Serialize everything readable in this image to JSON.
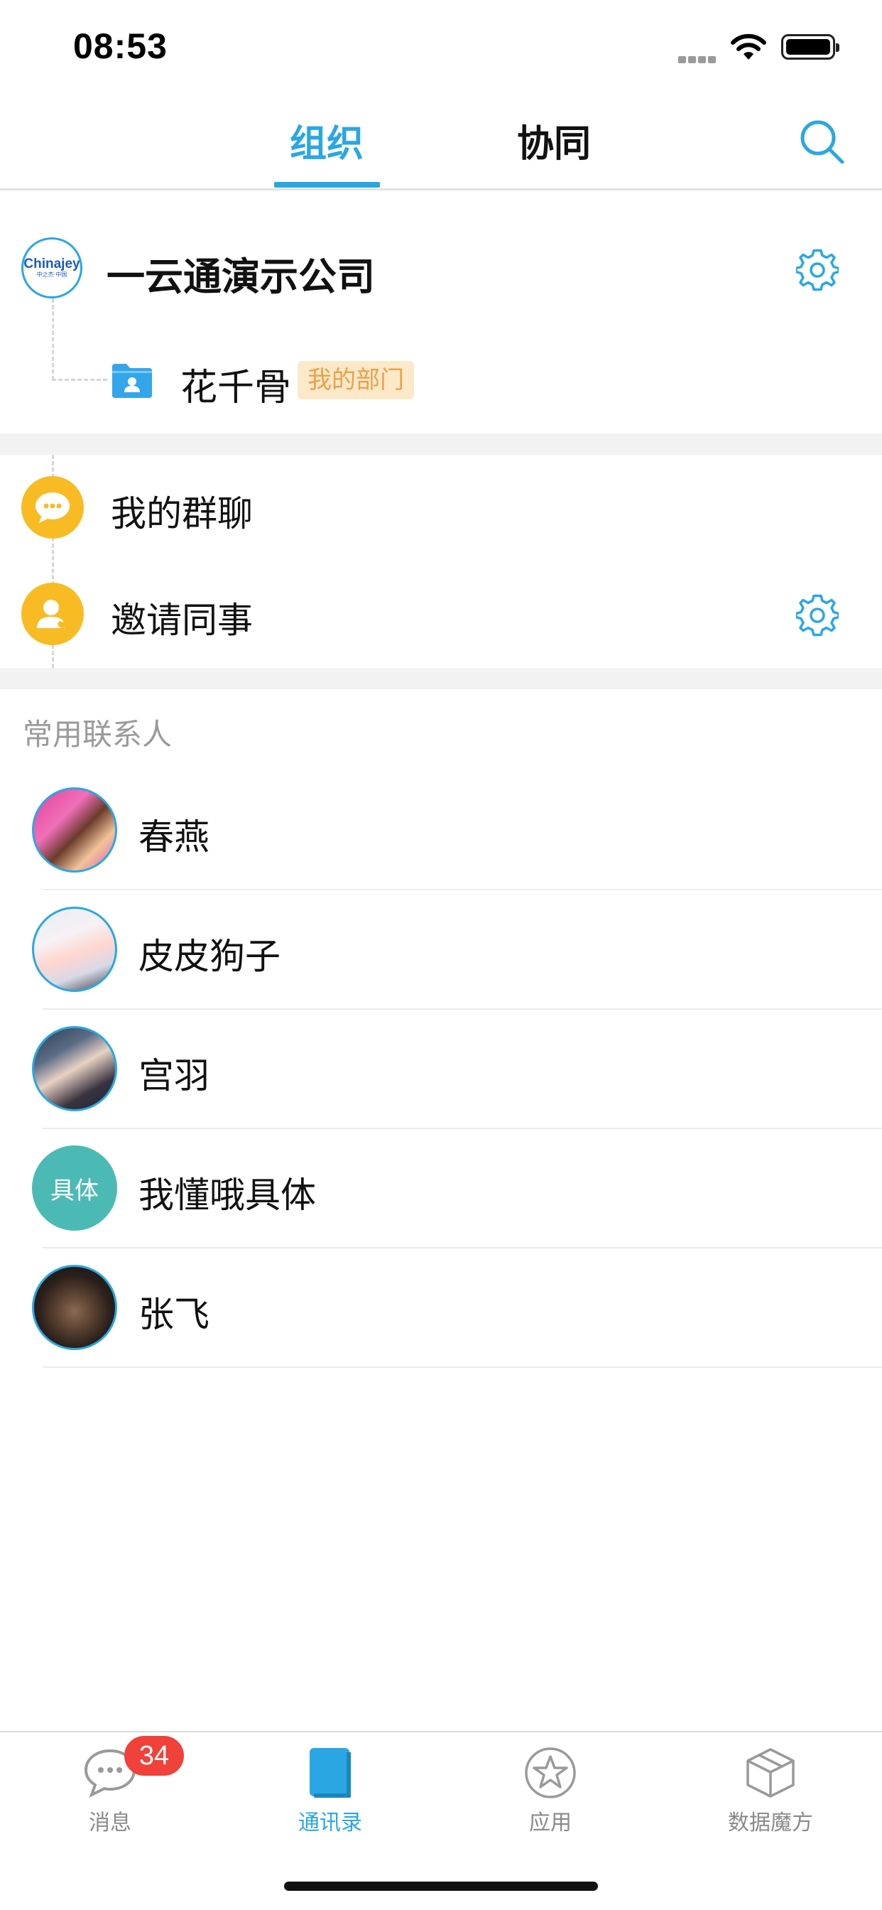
{
  "status_bar": {
    "time": "08:53"
  },
  "header": {
    "tabs": [
      {
        "label": "组织",
        "active": true
      },
      {
        "label": "协同",
        "active": false
      }
    ]
  },
  "org": {
    "company_logo_text": "Chinajey",
    "company_logo_sub": "中之杰·中国",
    "company_name": "一云通演示公司",
    "department": {
      "name": "花千骨",
      "tag": "我的部门"
    }
  },
  "quick_items": [
    {
      "label": "我的群聊",
      "icon": "chat-bubble-icon"
    },
    {
      "label": "邀请同事",
      "icon": "add-person-icon"
    }
  ],
  "frequent_contacts": {
    "title": "常用联系人",
    "items": [
      {
        "name": "春燕",
        "avatar": "photo"
      },
      {
        "name": "皮皮狗子",
        "avatar": "photo"
      },
      {
        "name": "宫羽",
        "avatar": "photo"
      },
      {
        "name": "我懂哦具体",
        "avatar_text": "具体"
      },
      {
        "name": "张飞",
        "avatar": "photo"
      }
    ]
  },
  "tabbar": {
    "items": [
      {
        "label": "消息",
        "icon": "message-icon",
        "badge": "34",
        "active": false
      },
      {
        "label": "通讯录",
        "icon": "contacts-book-icon",
        "active": true
      },
      {
        "label": "应用",
        "icon": "star-icon",
        "active": false
      },
      {
        "label": "数据魔方",
        "icon": "cube-icon",
        "active": false
      }
    ]
  },
  "colors": {
    "accent": "#2aa7e3",
    "icon_yellow": "#f9bb24",
    "tag_bg": "#fde9c9",
    "tag_text": "#e8a24a",
    "badge": "#f0413a",
    "text_avatar_bg": "#4cbab4"
  }
}
